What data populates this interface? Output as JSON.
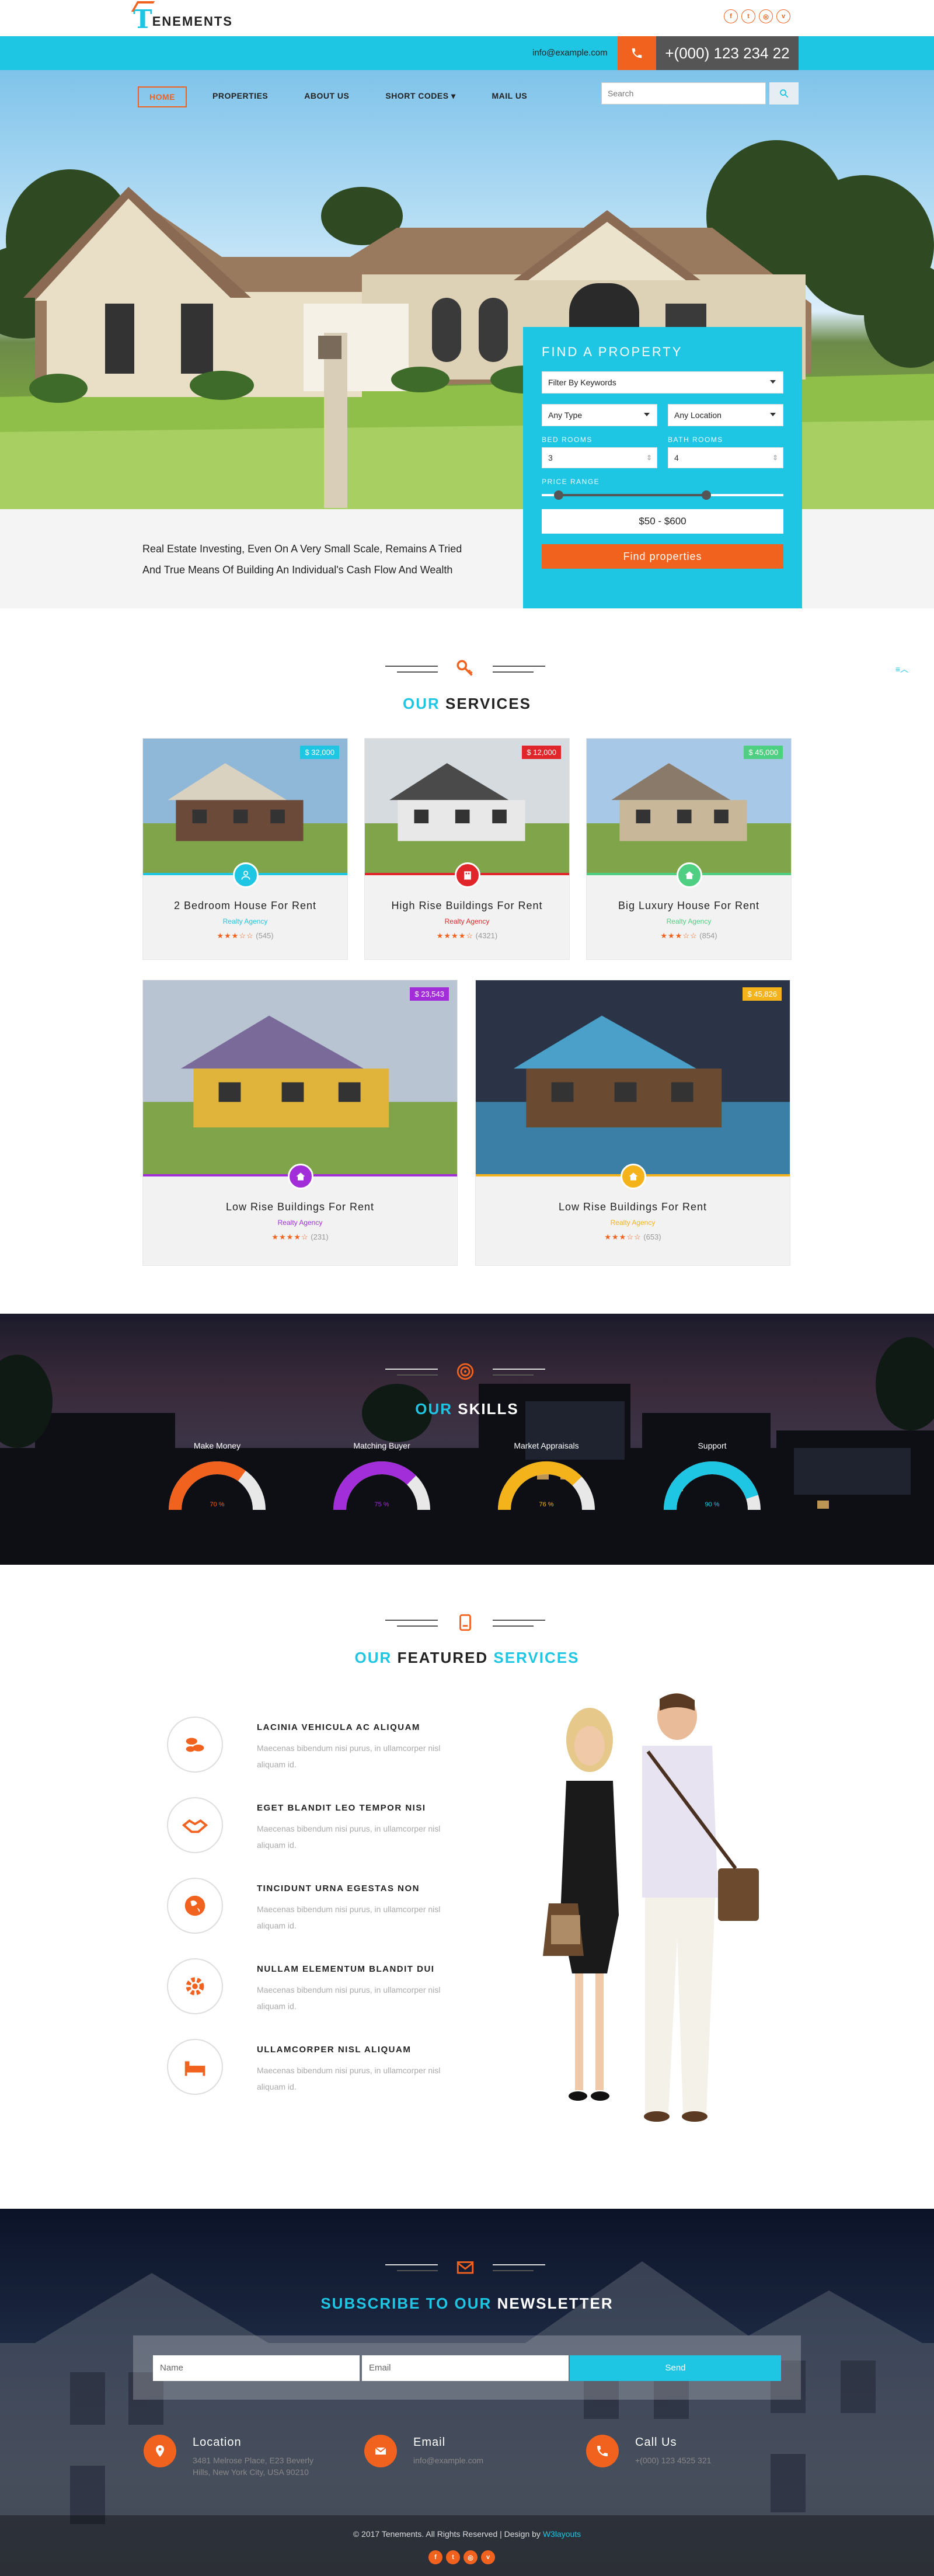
{
  "header": {
    "logo_letter": "T",
    "logo_text": "ENEMENTS",
    "social_icons": [
      "facebook-icon",
      "twitter-icon",
      "instagram-icon",
      "vimeo-icon"
    ],
    "email": "info@example.com",
    "phone": "+(000) 123 234 22"
  },
  "nav": {
    "items": [
      "HOME",
      "PROPERTIES",
      "ABOUT US",
      "SHORT CODES ▾",
      "MAIL US"
    ],
    "search_placeholder": "Search"
  },
  "hero": {
    "tagline": "Real Estate Investing, Even On A Very Small Scale, Remains A Tried And True Means Of Building An Individual's Cash Flow And Wealth"
  },
  "find_property": {
    "title": "FIND A PROPERTY",
    "keywords": "Filter By Keywords",
    "type": "Any Type",
    "location": "Any Location",
    "bed_label": "BED ROOMS",
    "bath_label": "BATH ROOMS",
    "bed_value": "3",
    "bath_value": "4",
    "price_label": "PRICE RANGE",
    "price_min_fraction": 0.07,
    "price_max_fraction": 0.68,
    "price_value": "$50 - $600",
    "button": "Find properties"
  },
  "services": {
    "title_accent": "OUR",
    "title_rest": "SERVICES",
    "cards": [
      {
        "price": "$ 32,000",
        "price_color": "#1fc6e3",
        "title": "2 Bedroom House For Rent",
        "agency": "Realty Agency",
        "agency_color": "#1fc6e3",
        "stars": "★★★☆☆",
        "count": "(545)",
        "icon": "user-icon",
        "color": "#1fc6e3"
      },
      {
        "price": "$ 12,000",
        "price_color": "#e0262b",
        "title": "High Rise Buildings For Rent",
        "agency": "Realty Agency",
        "agency_color": "#e0262b",
        "stars": "★★★★☆",
        "count": "(4321)",
        "icon": "building-icon",
        "color": "#e0262b"
      },
      {
        "price": "$ 45,000",
        "price_color": "#4fcf82",
        "title": "Big Luxury House For Rent",
        "agency": "Realty Agency",
        "agency_color": "#4fcf82",
        "stars": "★★★☆☆",
        "count": "(854)",
        "icon": "home-icon",
        "color": "#4fcf82"
      },
      {
        "price": "$ 23,543",
        "price_color": "#a12ed8",
        "title": "Low Rise Buildings For Rent",
        "agency": "Realty Agency",
        "agency_color": "#a12ed8",
        "stars": "★★★★☆",
        "count": "(231)",
        "icon": "home-icon",
        "color": "#a12ed8"
      },
      {
        "price": "$ 45,826",
        "price_color": "#f4b31a",
        "title": "Low Rise Buildings For Rent",
        "agency": "Realty Agency",
        "agency_color": "#f4b31a",
        "stars": "★★★☆☆",
        "count": "(653)",
        "icon": "home-icon",
        "color": "#f4b31a"
      }
    ]
  },
  "skills": {
    "title_accent": "OUR",
    "title_rest": "SKILLS",
    "items": [
      {
        "name": "Make Money",
        "value": "70 %",
        "fraction": 0.7,
        "color": "#f2621f"
      },
      {
        "name": "Matching Buyer",
        "value": "75 %",
        "fraction": 0.75,
        "color": "#a12ed8"
      },
      {
        "name": "Market Appraisals",
        "value": "76 %",
        "fraction": 0.76,
        "color": "#f4b31a"
      },
      {
        "name": "Support",
        "value": "90 %",
        "fraction": 0.9,
        "color": "#1fc6e3"
      }
    ]
  },
  "featured": {
    "title_accent": "OUR",
    "title_mid": "FEATURED",
    "title_end": "SERVICES",
    "items": [
      {
        "title": "LACINIA VEHICULA AC ALIQUAM",
        "text": "Maecenas bibendum nisi purus, in ullamcorper nisl aliquam id.",
        "icon": "coins-icon"
      },
      {
        "title": "EGET BLANDIT LEO TEMPOR NISI",
        "text": "Maecenas bibendum nisi purus, in ullamcorper nisl aliquam id.",
        "icon": "handshake-icon"
      },
      {
        "title": "TINCIDUNT URNA EGESTAS NON",
        "text": "Maecenas bibendum nisi purus, in ullamcorper nisl aliquam id.",
        "icon": "globe-icon"
      },
      {
        "title": "NULLAM ELEMENTUM BLANDIT DUI",
        "text": "Maecenas bibendum nisi purus, in ullamcorper nisl aliquam id.",
        "icon": "gear-icon"
      },
      {
        "title": "ULLAMCORPER NISL ALIQUAM",
        "text": "Maecenas bibendum nisi purus, in ullamcorper nisl aliquam id.",
        "icon": "bed-icon"
      }
    ]
  },
  "newsletter": {
    "title_accent": "SUBSCRIBE TO OUR",
    "title_rest": "NEWSLETTER",
    "name_placeholder": "Name",
    "email_placeholder": "Email",
    "send": "Send"
  },
  "contact": [
    {
      "title": "Location",
      "text": "3481 Melrose Place, E23 Beverly Hills, New York City, USA 90210",
      "icon": "map-pin-icon"
    },
    {
      "title": "Email",
      "text": "info@example.com",
      "icon": "envelope-icon"
    },
    {
      "title": "Call Us",
      "text": "+(000) 123 4525 321",
      "icon": "phone-icon"
    }
  ],
  "footer": {
    "copyright": "© 2017 Tenements. All Rights Reserved | Design by",
    "designer": "W3layouts"
  },
  "colors": {
    "accent": "#1fc6e3",
    "orange": "#f2621f"
  }
}
